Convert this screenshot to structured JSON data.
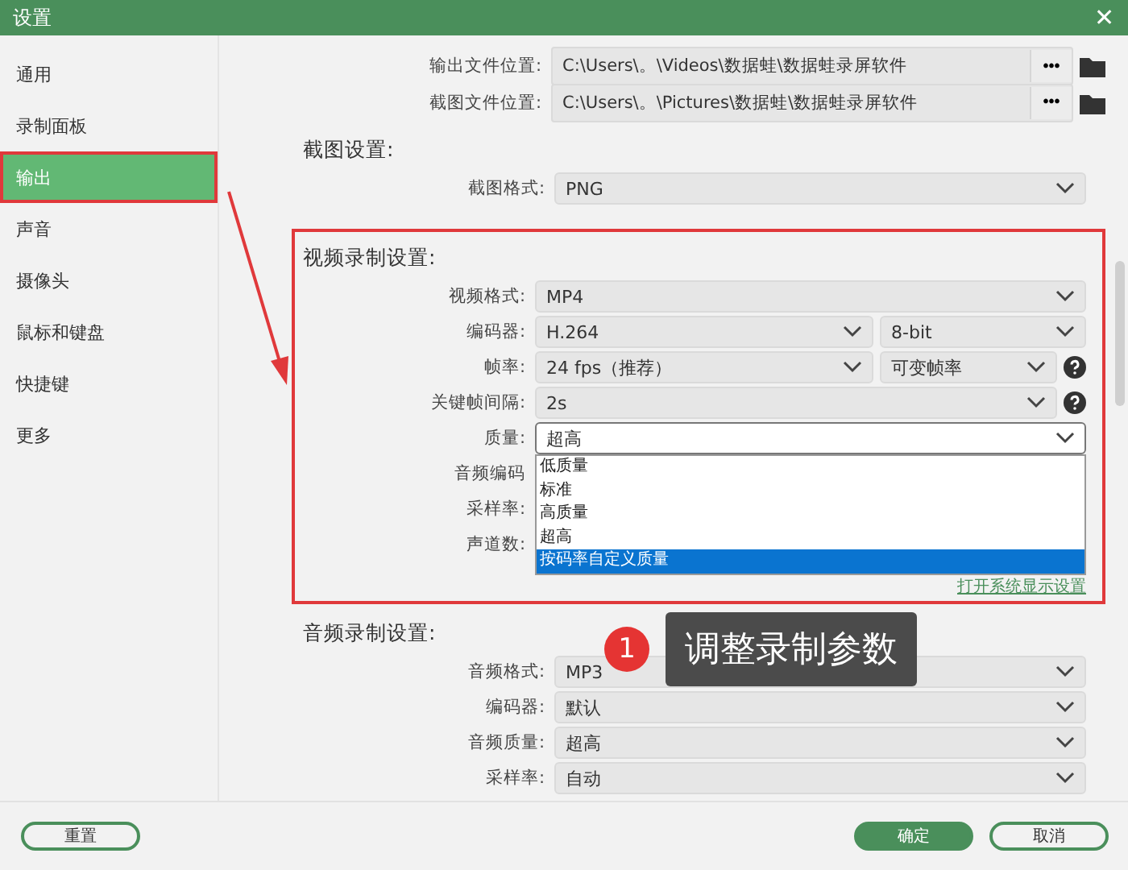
{
  "window": {
    "title": "设置",
    "close": "✕"
  },
  "sidebar": {
    "items": [
      {
        "label": "通用",
        "selected": false,
        "annotated": false
      },
      {
        "label": "录制面板",
        "selected": false,
        "annotated": false
      },
      {
        "label": "输出",
        "selected": true,
        "annotated": true
      },
      {
        "label": "声音",
        "selected": false,
        "annotated": false
      },
      {
        "label": "摄像头",
        "selected": false,
        "annotated": false
      },
      {
        "label": "鼠标和键盘",
        "selected": false,
        "annotated": false
      },
      {
        "label": "快捷键",
        "selected": false,
        "annotated": false
      },
      {
        "label": "更多",
        "selected": false,
        "annotated": false
      }
    ]
  },
  "paths": [
    {
      "label": "输出文件位置:",
      "value": "C:\\Users\\。\\Videos\\数据蛙\\数据蛙录屏软件",
      "more": "•••"
    },
    {
      "label": "截图文件位置:",
      "value": "C:\\Users\\。\\Pictures\\数据蛙\\数据蛙录屏软件",
      "more": "•••"
    }
  ],
  "sections": [
    {
      "title": "截图设置:",
      "rows": [
        {
          "label": "截图格式:",
          "fields": [
            "PNG"
          ]
        }
      ]
    },
    {
      "title": "视频录制设置:",
      "annotated": true,
      "rows": [
        {
          "label": "视频格式:",
          "fields": [
            "MP4"
          ]
        },
        {
          "label": "编码器:",
          "fields": [
            "H.264",
            "8-bit"
          ]
        },
        {
          "label": "帧率:",
          "fields": [
            "24 fps（推荐）",
            "可变帧率"
          ],
          "help": true
        },
        {
          "label": "关键帧间隔:",
          "fields": [
            "2s"
          ],
          "help": true
        },
        {
          "label": "质量:",
          "fields": [
            "超高"
          ],
          "open": true,
          "options": [
            {
              "label": "低质量",
              "selected": false
            },
            {
              "label": "标准",
              "selected": false
            },
            {
              "label": "高质量",
              "selected": false
            },
            {
              "label": "超高",
              "selected": false
            },
            {
              "label": "按码率自定义质量",
              "selected": true
            }
          ]
        },
        {
          "label": "音频编码",
          "fields": []
        },
        {
          "label": "采样率:",
          "fields": []
        },
        {
          "label": "声道数:",
          "fields": []
        }
      ],
      "link": "打开系统显示设置"
    },
    {
      "title": "音频录制设置:",
      "rows": [
        {
          "label": "音频格式:",
          "fields": [
            "MP3"
          ]
        },
        {
          "label": "编码器:",
          "fields": [
            "默认"
          ]
        },
        {
          "label": "音频质量:",
          "fields": [
            "超高"
          ]
        },
        {
          "label": "采样率:",
          "fields": [
            "自动"
          ]
        }
      ]
    }
  ],
  "callout": {
    "number": "1",
    "text": "调整录制参数"
  },
  "buttons": [
    {
      "label": "重置",
      "kind": "outline"
    },
    {
      "label": "确定",
      "kind": "primary"
    },
    {
      "label": "取消",
      "kind": "outline"
    }
  ]
}
